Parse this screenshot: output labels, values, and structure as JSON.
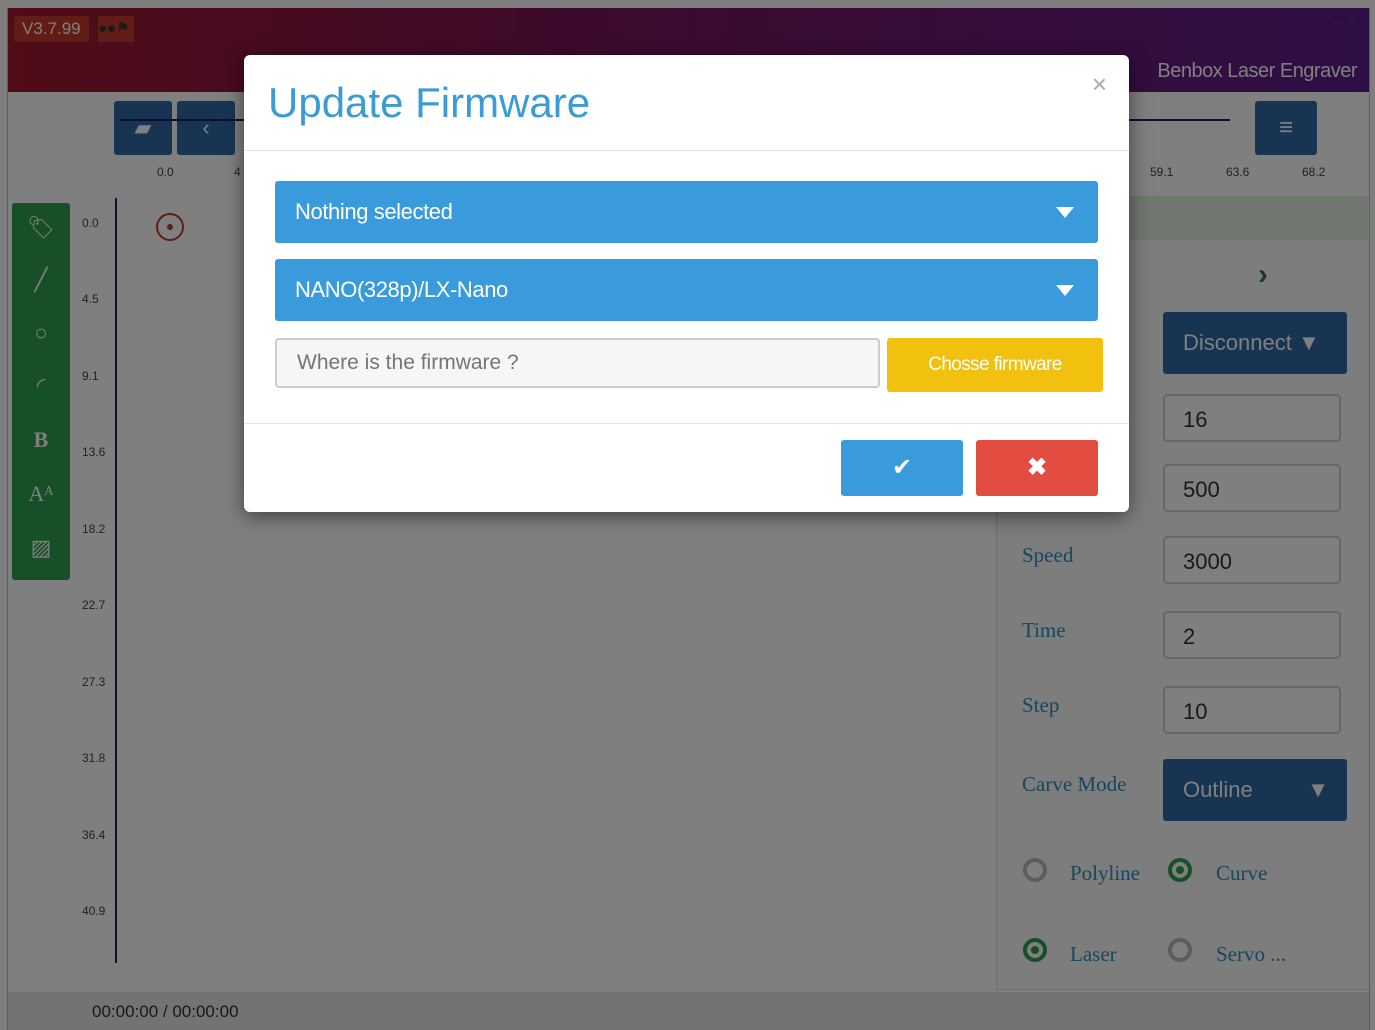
{
  "titlebar": {
    "version": "V3.7.99",
    "app_name": "Benbox Laser Engraver",
    "window_controls": "– ×"
  },
  "toolbar": {
    "open_icon": "folder-open-icon",
    "back_icon": "chevron-left-icon",
    "menu_icon": "hamburger-menu-icon"
  },
  "ruler": {
    "top_ticks": [
      "0.0",
      "4",
      "59.1",
      "63.6",
      "68.2"
    ],
    "left_ticks": [
      "0.0",
      "4.5",
      "9.1",
      "13.6",
      "18.2",
      "22.7",
      "27.3",
      "31.8",
      "36.4",
      "40.9"
    ]
  },
  "left_tools": [
    {
      "icon": "tag-icon",
      "glyph": "🏷"
    },
    {
      "icon": "line-icon",
      "glyph": "╱"
    },
    {
      "icon": "circle-icon",
      "glyph": "○"
    },
    {
      "icon": "arc-icon",
      "glyph": "◜"
    },
    {
      "icon": "bold-text-icon",
      "glyph": "B"
    },
    {
      "icon": "font-icon",
      "glyph": "Aᴬ"
    },
    {
      "icon": "image-icon",
      "glyph": "▨"
    }
  ],
  "right_panel": {
    "disconnect_label": "Disconnect ▼",
    "field_values": [
      "16",
      "500",
      "3000",
      "2",
      "10"
    ],
    "labels": {
      "speed": "Speed",
      "time": "Time",
      "step": "Step",
      "carve_mode": "Carve Mode"
    },
    "carve_mode_value": "Outline",
    "radios": {
      "polyline": {
        "label": "Polyline",
        "checked": false
      },
      "curve": {
        "label": "Curve",
        "checked": true
      },
      "laser": {
        "label": "Laser",
        "checked": true
      },
      "servo": {
        "label": "Servo ...",
        "checked": false
      }
    }
  },
  "statusbar": {
    "time": "00:00:00 / 00:00:00"
  },
  "modal": {
    "title": "Update Firmware",
    "close_glyph": "×",
    "select1": "Nothing selected",
    "select2": "NANO(328p)/LX-Nano",
    "firmware_placeholder": "Where is the firmware ?",
    "choose_label": "Chosse firmware",
    "ok_glyph": "✔",
    "cancel_glyph": "✖"
  },
  "colors": {
    "accent_blue": "#3a9bdc",
    "choose_yellow": "#f2c00e",
    "cancel_red": "#e34c40",
    "tool_green": "#2e9e4f"
  }
}
